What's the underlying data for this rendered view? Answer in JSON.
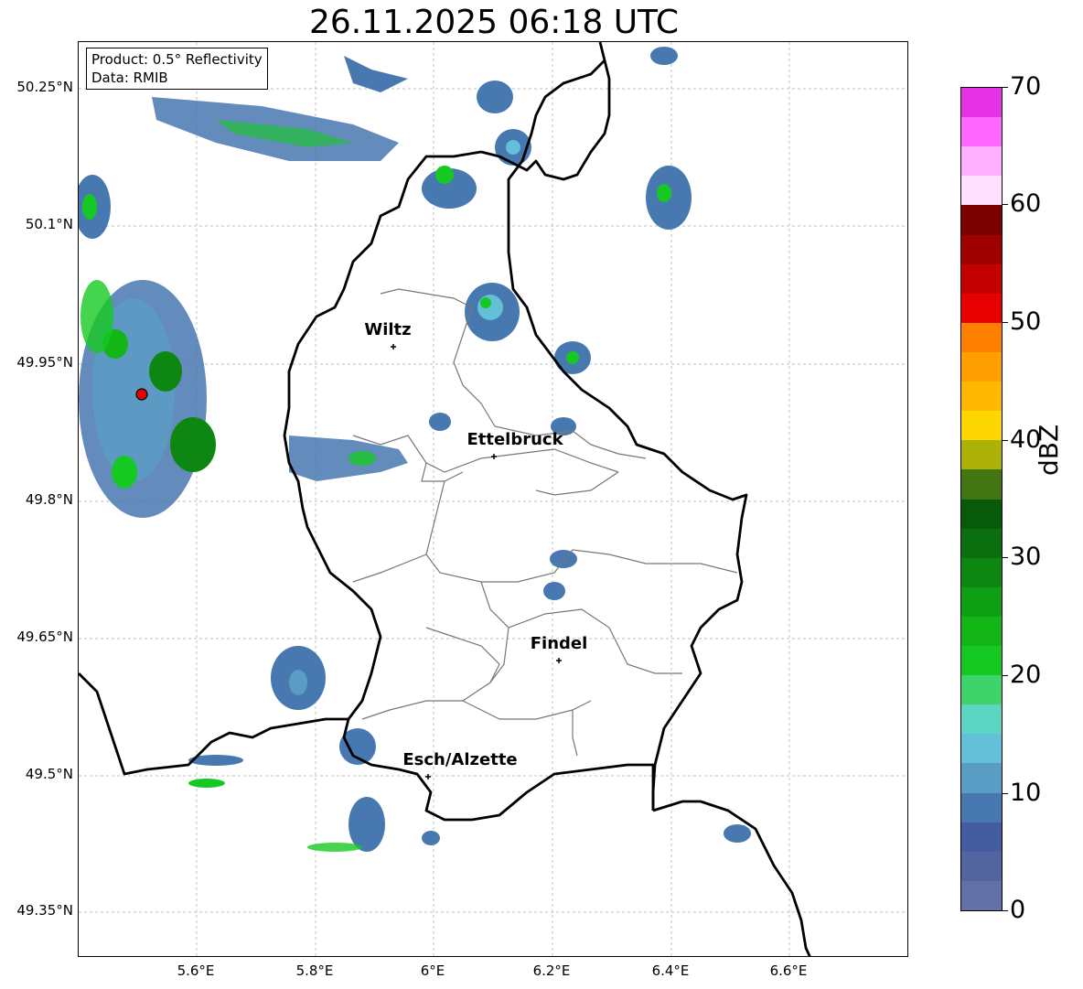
{
  "title": "26.11.2025 06:18 UTC",
  "info": {
    "product": "Product: 0.5° Reflectivity",
    "data": "Data: RMIB"
  },
  "axes": {
    "lat_labels": [
      "50.25°N",
      "50.1°N",
      "49.95°N",
      "49.8°N",
      "49.65°N",
      "49.5°N",
      "49.35°N"
    ],
    "lon_labels": [
      "5.6°E",
      "5.8°E",
      "6°E",
      "6.2°E",
      "6.4°E",
      "6.6°E"
    ]
  },
  "cities": [
    {
      "name": "Wiltz"
    },
    {
      "name": "Ettelbruck"
    },
    {
      "name": "Findel"
    },
    {
      "name": "Esch/Alzette"
    }
  ],
  "colorbar": {
    "label": "dBZ",
    "ticks": [
      "0",
      "10",
      "20",
      "30",
      "40",
      "50",
      "60",
      "70"
    ],
    "range": [
      0,
      70
    ],
    "colors": [
      "#6272a8",
      "#52659f",
      "#445da1",
      "#4878b0",
      "#5a9dc4",
      "#63c0d8",
      "#5bd6c2",
      "#3fd36c",
      "#16c922",
      "#13b517",
      "#0f9f14",
      "#0e8612",
      "#0b6f0f",
      "#085a0b",
      "#437512",
      "#adb208",
      "#ffd700",
      "#ffb700",
      "#ffa000",
      "#ff8000",
      "#e60000",
      "#c50000",
      "#a10000",
      "#7b0000",
      "#ffe0ff",
      "#ffb0ff",
      "#ff66ff",
      "#e633e6"
    ]
  },
  "radar_marker": "red-dot"
}
